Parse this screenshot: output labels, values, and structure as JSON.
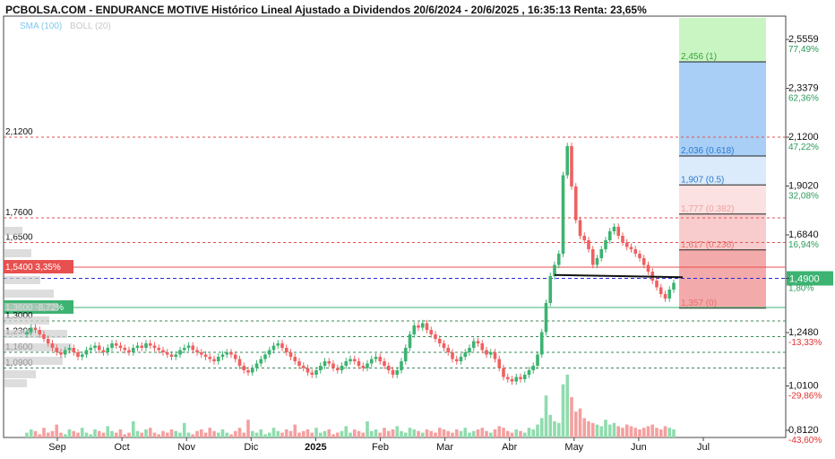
{
  "title": "PCBOLSA.COM - ENDURANCE MOTIVE Histórico Lineal Ajustado a Dividendos 20/6/2024 - 20/6/2025 , 16:35:13 Renta: 23,65%",
  "legend": [
    {
      "label": "SMA (100)",
      "color": "#7ec8f0"
    },
    {
      "label": "BOLL (20)",
      "color": "#c8c8c8"
    }
  ],
  "colors": {
    "up": "#3cb371",
    "down": "#f06060",
    "vol_up": "#8fdcae",
    "vol_down": "#f4a0a0",
    "fib_green": "#c9f5c3",
    "fib_blue": "#a9cff7",
    "fib_lightblue": "#dcebfb",
    "fib_pink": "#fbe1e1",
    "fib_red": "#f3aaaa"
  },
  "chart_data": {
    "type": "candlestick",
    "x_labels": [
      "Sep",
      "Oct",
      "Nov",
      "Dic",
      "2025",
      "Feb",
      "Mar",
      "Abr",
      "May",
      "Jun",
      "Jul"
    ],
    "y_range": [
      0.78,
      2.66
    ],
    "right_axis": [
      {
        "price": "2,5559",
        "pct": "77,49%"
      },
      {
        "price": "2,3379",
        "pct": "62,36%"
      },
      {
        "price": "2,1200",
        "pct": "47,22%"
      },
      {
        "price": "1,9020",
        "pct": "32,08%"
      },
      {
        "price": "1,6840",
        "pct": "16,94%"
      },
      {
        "price": "1,4900",
        "pct": "1,80%"
      },
      {
        "price": "1,2480",
        "pct": "-13,33%"
      },
      {
        "price": "1,0100",
        "pct": "-29,86%"
      },
      {
        "price": "0,8120",
        "pct": "-43,60%"
      }
    ],
    "left_levels": [
      {
        "label": "2,1200"
      },
      {
        "label": "1,7600"
      },
      {
        "label": "1,6500"
      },
      {
        "label": "1,5400",
        "pct": "3,35%",
        "boxed": true,
        "color": "#e85050"
      },
      {
        "label": "1,3600",
        "pct": "-8,72%",
        "boxed": true,
        "color": "#3cb371"
      },
      {
        "label": "1,3000"
      },
      {
        "label": "1,2300"
      },
      {
        "label": "1,1600"
      },
      {
        "label": "1,0900"
      }
    ],
    "current_price": "1,4900",
    "fibonacci": [
      {
        "label": "2,456 (1)",
        "color": "#3aa33a"
      },
      {
        "label": "2,036 (0.618)",
        "color": "#2a7ad0"
      },
      {
        "label": "1,907 (0.5)",
        "color": "#2a7ad0"
      },
      {
        "label": "1,777 (0.382)",
        "color": "#f0a0a0"
      },
      {
        "label": "1,617 (0.236)",
        "color": "#e87070"
      },
      {
        "label": "1,357 (0)",
        "color": "#e87070"
      }
    ],
    "series": [
      {
        "name": "Precio",
        "values": [
          1.25,
          1.27,
          1.26,
          1.24,
          1.22,
          1.2,
          1.18,
          1.16,
          1.15,
          1.17,
          1.18,
          1.16,
          1.14,
          1.15,
          1.17,
          1.18,
          1.19,
          1.17,
          1.16,
          1.18,
          1.2,
          1.19,
          1.18,
          1.17,
          1.16,
          1.18,
          1.19,
          1.18,
          1.2,
          1.19,
          1.18,
          1.17,
          1.16,
          1.15,
          1.14,
          1.15,
          1.17,
          1.18,
          1.19,
          1.17,
          1.16,
          1.15,
          1.14,
          1.13,
          1.12,
          1.14,
          1.15,
          1.16,
          1.15,
          1.13,
          1.1,
          1.08,
          1.07,
          1.09,
          1.11,
          1.13,
          1.15,
          1.17,
          1.19,
          1.2,
          1.18,
          1.16,
          1.14,
          1.12,
          1.1,
          1.09,
          1.07,
          1.06,
          1.08,
          1.1,
          1.12,
          1.11,
          1.09,
          1.08,
          1.1,
          1.12,
          1.13,
          1.12,
          1.1,
          1.09,
          1.11,
          1.13,
          1.14,
          1.12,
          1.1,
          1.08,
          1.06,
          1.08,
          1.12,
          1.18,
          1.24,
          1.28,
          1.27,
          1.29,
          1.26,
          1.24,
          1.22,
          1.2,
          1.18,
          1.16,
          1.13,
          1.12,
          1.14,
          1.16,
          1.18,
          1.21,
          1.2,
          1.17,
          1.15,
          1.16,
          1.13,
          1.09,
          1.05,
          1.04,
          1.03,
          1.05,
          1.04,
          1.06,
          1.08,
          1.1,
          1.15,
          1.25,
          1.38,
          1.5,
          1.55,
          1.6,
          1.95,
          2.08,
          1.9,
          1.75,
          1.68,
          1.66,
          1.62,
          1.55,
          1.58,
          1.62,
          1.66,
          1.7,
          1.72,
          1.68,
          1.65,
          1.63,
          1.62,
          1.6,
          1.58,
          1.55,
          1.52,
          1.48,
          1.45,
          1.42,
          1.4,
          1.44,
          1.47
        ]
      }
    ],
    "volumes": [
      {
        "name": "Volumen",
        "values": [
          0.3,
          0.5,
          0.4,
          0.2,
          0.6,
          0.3,
          0.4,
          0.8,
          0.3,
          0.2,
          0.5,
          0.4,
          0.3,
          0.6,
          0.3,
          0.2,
          0.5,
          0.4,
          0.3,
          0.7,
          0.4,
          0.3,
          0.5,
          0.2,
          0.3,
          1.0,
          0.4,
          0.3,
          0.5,
          0.6,
          0.3,
          0.2,
          0.4,
          0.3,
          0.5,
          0.4,
          0.3,
          0.9,
          0.3,
          0.2,
          0.4,
          0.5,
          0.3,
          0.6,
          0.4,
          0.3,
          0.5,
          0.3,
          0.2,
          0.4,
          0.6,
          0.3,
          1.1,
          0.4,
          0.3,
          0.5,
          0.2,
          0.3,
          0.6,
          0.4,
          0.3,
          0.5,
          0.4,
          0.8,
          0.3,
          0.4,
          0.5,
          0.3,
          0.6,
          0.3,
          0.4,
          0.5,
          0.2,
          0.3,
          0.4,
          0.7,
          0.3,
          0.5,
          0.4,
          0.3,
          1.0,
          0.4,
          0.5,
          0.3,
          0.6,
          0.4,
          0.5,
          0.7,
          0.4,
          0.3,
          0.6,
          0.5,
          0.4,
          0.3,
          0.5,
          0.4,
          0.3,
          0.6,
          0.5,
          0.4,
          0.3,
          0.5,
          0.4,
          0.6,
          0.3,
          0.4,
          0.5,
          0.6,
          0.4,
          0.3,
          0.5,
          0.7,
          0.6,
          0.4,
          0.3,
          0.5,
          0.4,
          0.3,
          0.6,
          0.5,
          0.8,
          1.2,
          2.6,
          1.4,
          1.0,
          0.9,
          3.3,
          3.9,
          2.5,
          1.6,
          1.8,
          1.2,
          1.0,
          0.9,
          0.8,
          0.7,
          1.1,
          0.8,
          0.9,
          0.7,
          0.6,
          0.8,
          0.7,
          0.6,
          0.5,
          0.6,
          0.7,
          0.8,
          0.6,
          0.5,
          0.7,
          0.6,
          0.5
        ]
      }
    ]
  }
}
